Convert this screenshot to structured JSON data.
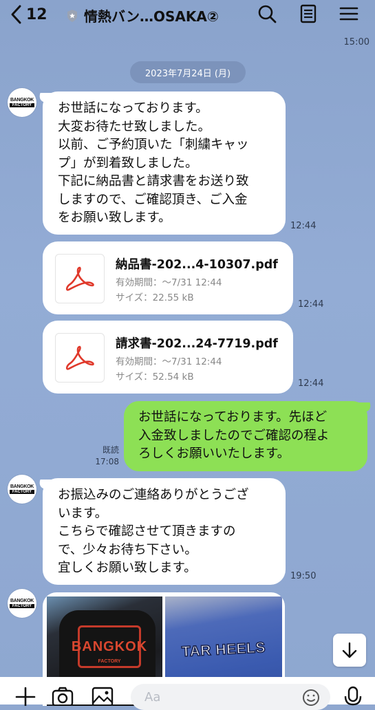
{
  "header": {
    "back_count": "12",
    "title": "情熱バン…OSAKA②"
  },
  "top_timestamp": "15:00",
  "date_separator": "2023年7月24日 (月)",
  "avatar": {
    "line1": "BANGKOK",
    "line2": "FACTORY"
  },
  "messages": [
    {
      "text": "お世話になっております。\n大変お待たせ致しました。\n以前、ご予約頂いた「刺繍キャッ\nプ」が到着致しました。\n下記に納品書と請求書をお送り致\nしますので、ご確認頂き、ご入金\nをお願い致します。",
      "time": "12:44"
    },
    {
      "file_name": "納品書-202...4-10307.pdf",
      "expiry": "有効期間：〜7/31 12:44",
      "size": "サイズ：22.55 kB",
      "time": "12:44"
    },
    {
      "file_name": "請求書-202...24-7719.pdf",
      "expiry": "有効期間：〜7/31 12:44",
      "size": "サイズ：52.54 kB",
      "time": "12:44"
    },
    {
      "text": "お世話になっております。先ほど\n入金致しましたのでご確認の程よ\nろしくお願いいたします。",
      "read_label": "既読",
      "time": "17:08"
    },
    {
      "text": "お振込みのご連絡ありがとうござ\nいます。\nこちらで確認させて頂きますの\nで、少々お待ち下さい。\n宜しくお願い致します。",
      "time": "19:50"
    },
    {
      "photo_texts": [
        "BANGKOK",
        "FACTORY",
        "TAR HEELS"
      ]
    }
  ],
  "input": {
    "placeholder": "Aa"
  },
  "icons": {
    "back": "chevron-left-icon",
    "shield": "shield-icon",
    "search": "search-icon",
    "notes": "notes-icon",
    "menu": "menu-icon",
    "pdf": "pdf-icon",
    "scroll_down": "arrow-down-icon",
    "add": "plus-icon",
    "camera": "camera-icon",
    "image": "image-icon",
    "emoji": "emoji-icon",
    "mic": "mic-icon"
  },
  "colors": {
    "background": "#8fa7cf",
    "outgoing_bubble": "#8de055",
    "incoming_bubble": "#ffffff",
    "pdf_red": "#e0392b"
  }
}
